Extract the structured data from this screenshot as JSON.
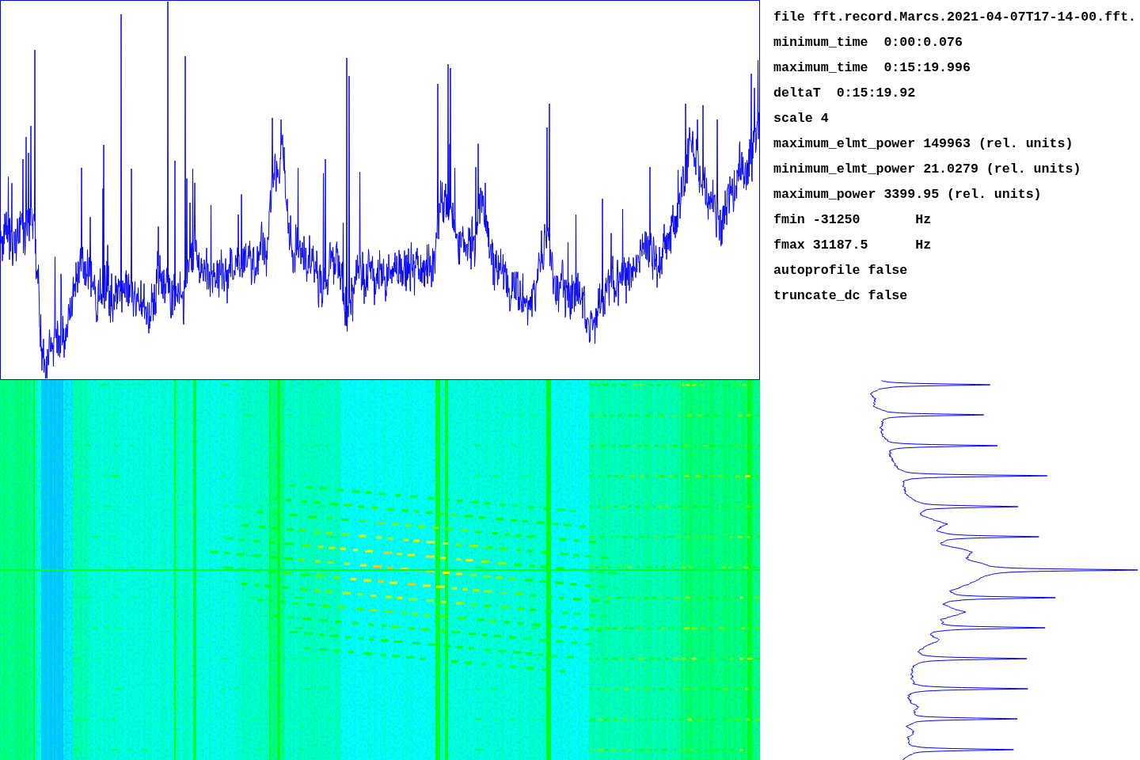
{
  "info": {
    "lines": [
      "file fft.record.Marcs.2021-04-07T17-14-00.fft.",
      "minimum_time  0:00:0.076",
      "maximum_time  0:15:19.996",
      "deltaT  0:15:19.92",
      "scale 4",
      "maximum_elmt_power 149963 (rel. units)",
      "minimum_elmt_power 21.0279 (rel. units)",
      "maximum_power 3399.95 (rel. units)",
      "fmin -31250       Hz",
      "fmax 31187.5      Hz",
      "autoprofile false",
      "truncate_dc false"
    ]
  }
}
